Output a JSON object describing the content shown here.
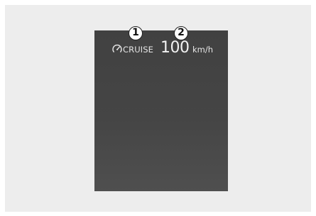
{
  "display": {
    "cruise_icon": "cruise-control-icon",
    "cruise_label": "CRUISE",
    "speed_value": "100",
    "speed_unit": "km/h"
  },
  "callouts": [
    {
      "label": "1"
    },
    {
      "label": "2"
    }
  ],
  "colors": {
    "background": "#ededed",
    "screen": "#444444",
    "text": "#f2f2f2"
  }
}
